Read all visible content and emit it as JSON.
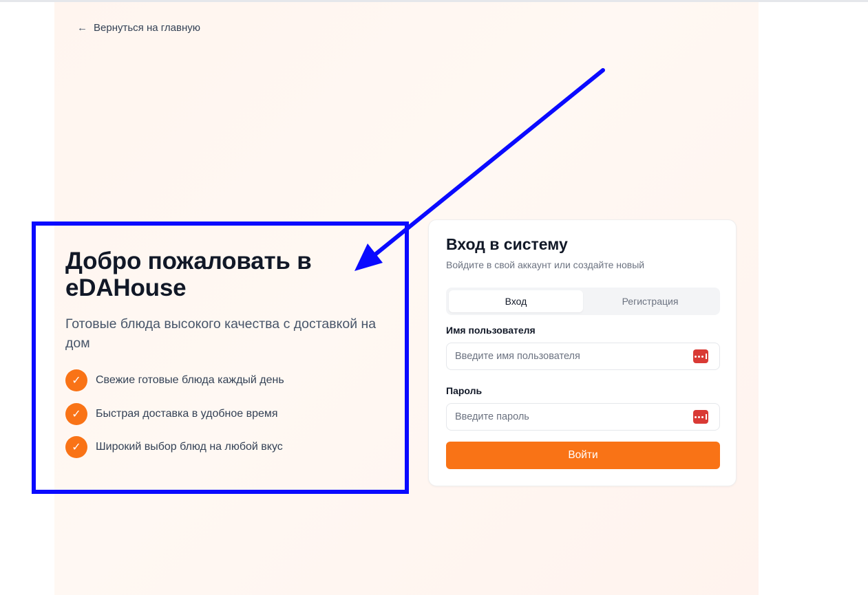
{
  "nav": {
    "back_label": "Вернуться на главную"
  },
  "hero": {
    "title": "Добро пожаловать в eDAHouse",
    "subtitle": "Готовые блюда высокого качества с доставкой на дом",
    "features": [
      {
        "text": "Свежие готовые блюда каждый день",
        "icon": "check-icon"
      },
      {
        "text": "Быстрая доставка в удобное время",
        "icon": "check-icon"
      },
      {
        "text": "Широкий выбор блюд на любой вкус",
        "icon": "check-icon"
      }
    ]
  },
  "login_card": {
    "title": "Вход в систему",
    "subtitle": "Войдите в свой аккаунт или создайте новый",
    "tabs": [
      {
        "label": "Вход",
        "active": true
      },
      {
        "label": "Регистрация",
        "active": false
      }
    ],
    "username": {
      "label": "Имя пользователя",
      "value": "",
      "placeholder": "Введите имя пользователя"
    },
    "password": {
      "label": "Пароль",
      "value": "",
      "placeholder": "Введите пароль"
    },
    "submit_label": "Войти"
  },
  "colors": {
    "accent": "#f97316",
    "annotation": "#0a0aff",
    "password_manager_icon": "#d93a35"
  }
}
